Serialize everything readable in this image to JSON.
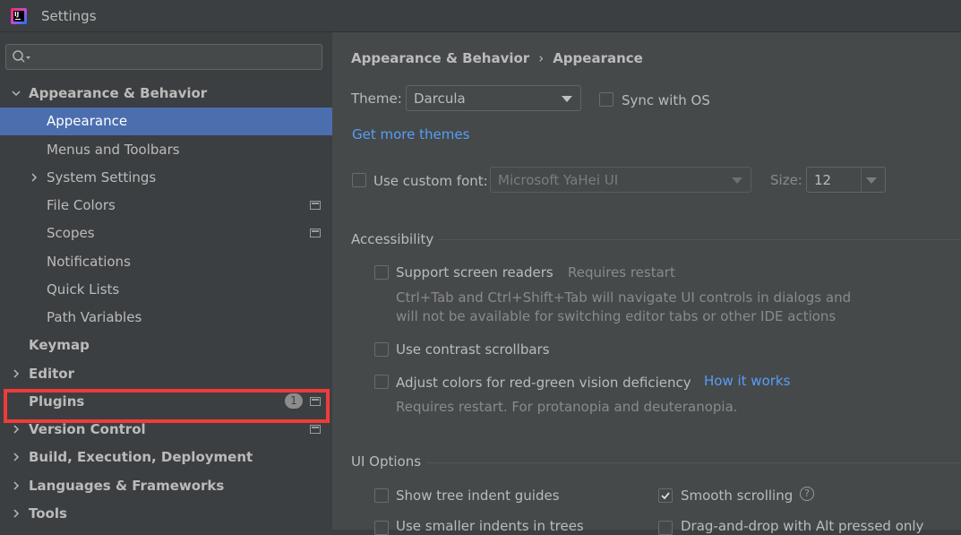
{
  "window": {
    "title": "Settings"
  },
  "search": {
    "placeholder": ""
  },
  "tree": [
    {
      "label": "Appearance & Behavior",
      "bold": true,
      "level": 0,
      "chevron": "down"
    },
    {
      "label": "Appearance",
      "bold": false,
      "level": 1,
      "selected": true
    },
    {
      "label": "Menus and Toolbars",
      "bold": false,
      "level": 1
    },
    {
      "label": "System Settings",
      "bold": false,
      "level": 1,
      "chevron": "right"
    },
    {
      "label": "File Colors",
      "bold": false,
      "level": 1,
      "project_icon": true
    },
    {
      "label": "Scopes",
      "bold": false,
      "level": 1,
      "project_icon": true
    },
    {
      "label": "Notifications",
      "bold": false,
      "level": 1
    },
    {
      "label": "Quick Lists",
      "bold": false,
      "level": 1
    },
    {
      "label": "Path Variables",
      "bold": false,
      "level": 1
    },
    {
      "label": "Keymap",
      "bold": true,
      "level": 0
    },
    {
      "label": "Editor",
      "bold": true,
      "level": 0,
      "chevron": "right"
    },
    {
      "label": "Plugins",
      "bold": true,
      "level": 0,
      "badge": "1",
      "project_icon": true,
      "highlighted": true
    },
    {
      "label": "Version Control",
      "bold": true,
      "level": 0,
      "chevron": "right",
      "project_icon": true
    },
    {
      "label": "Build, Execution, Deployment",
      "bold": true,
      "level": 0,
      "chevron": "right"
    },
    {
      "label": "Languages & Frameworks",
      "bold": true,
      "level": 0,
      "chevron": "right"
    },
    {
      "label": "Tools",
      "bold": true,
      "level": 0,
      "chevron": "right"
    }
  ],
  "content": {
    "breadcrumb": [
      "Appearance & Behavior",
      "Appearance"
    ],
    "breadcrumb_sep": "›",
    "theme": {
      "label": "Theme:",
      "value": "Darcula"
    },
    "sync_os": {
      "label": "Sync with OS",
      "checked": false
    },
    "more_themes": "Get more themes",
    "custom_font": {
      "label": "Use custom font:",
      "checked": false,
      "font_value": "Microsoft YaHei UI",
      "size_label": "Size:",
      "size_value": "12"
    },
    "accessibility": {
      "header": "Accessibility",
      "screen_readers": {
        "label": "Support screen readers",
        "note": "Requires restart",
        "checked": false
      },
      "screen_readers_desc_1": "Ctrl+Tab and Ctrl+Shift+Tab will navigate UI controls in dialogs and",
      "screen_readers_desc_2": "will not be available for switching editor tabs or other IDE actions",
      "contrast_scrollbars": {
        "label": "Use contrast scrollbars",
        "checked": false
      },
      "red_green": {
        "label": "Adjust colors for red-green vision deficiency",
        "link": "How it works",
        "checked": false
      },
      "red_green_desc": "Requires restart. For protanopia and deuteranopia."
    },
    "ui_options": {
      "header": "UI Options",
      "indent_guides": {
        "label": "Show tree indent guides",
        "checked": false
      },
      "smooth_scrolling": {
        "label": "Smooth scrolling",
        "checked": true
      },
      "smaller_indents": {
        "label": "Use smaller indents in trees",
        "checked": false
      },
      "drag_drop_alt": {
        "label": "Drag-and-drop with Alt pressed only",
        "checked": false
      }
    }
  },
  "colors": {
    "accent": "#4b6eaf",
    "link": "#589df6",
    "highlight": "#ef3b3b"
  }
}
